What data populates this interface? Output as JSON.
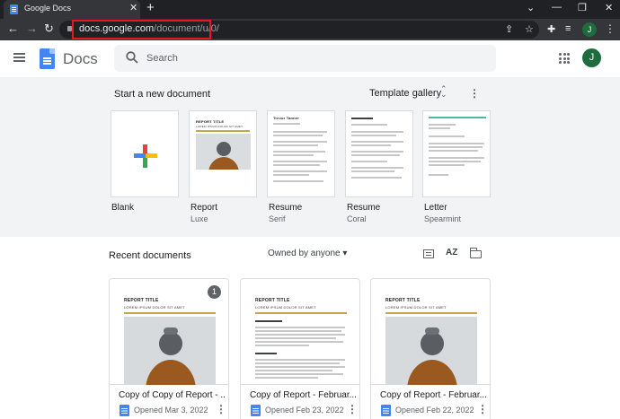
{
  "browser": {
    "tab_title": "Google Docs",
    "tab_close": "✕",
    "new_tab": "+",
    "url_domain": "docs.google.com",
    "url_path": "/document/u/0/",
    "profile_initial": "J"
  },
  "header": {
    "app_name": "Docs",
    "search_placeholder": "Search",
    "avatar_initial": "J"
  },
  "templates": {
    "section_title": "Start a new document",
    "gallery_label": "Template gallery",
    "items": [
      {
        "name": "Blank",
        "sub": ""
      },
      {
        "name": "Report",
        "sub": "Luxe"
      },
      {
        "name": "Resume",
        "sub": "Serif"
      },
      {
        "name": "Resume",
        "sub": "Coral"
      },
      {
        "name": "Letter",
        "sub": "Spearmint"
      }
    ],
    "resume_name": "Trevor Tanner",
    "thumb_title": "REPORT TITLE",
    "thumb_subtitle": "LOREM IPSUM DOLOR SIT AMET"
  },
  "recent": {
    "title": "Recent documents",
    "owner_filter": "Owned by anyone",
    "sort_label": "AZ",
    "docs": [
      {
        "title": "Copy of Copy of Report - ...",
        "date": "Opened Mar 3, 2022",
        "badge": "1",
        "thumb_title": "REPORT TITLE",
        "thumb_subtitle": "LOREM IPSUM DOLOR SIT AMET"
      },
      {
        "title": "Copy of Report - Februar...",
        "date": "Opened Feb 23, 2022",
        "badge": "",
        "thumb_title": "REPORT TITLE",
        "thumb_subtitle": "LOREM IPSUM DOLOR SIT AMET"
      },
      {
        "title": "Copy of Report - Februar...",
        "date": "Opened Feb 22, 2022",
        "badge": "",
        "thumb_title": "REPORT TITLE",
        "thumb_subtitle": "LOREM IPSUM DOLOR SIT AMET"
      }
    ]
  },
  "colors": {
    "chrome_dark": "#202124",
    "chrome_bar": "#35363a",
    "docs_blue": "#4285f4",
    "highlight_red": "#e8171f",
    "gallery_bg": "#f1f3f4",
    "avatar_green": "#1e6b3f"
  }
}
